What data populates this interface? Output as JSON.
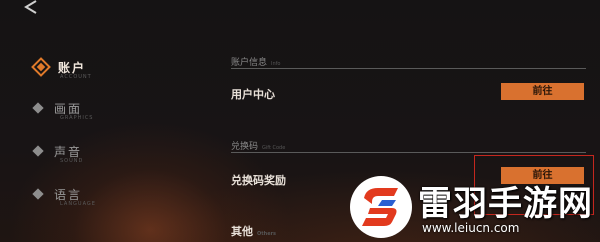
{
  "sidebar": {
    "items": [
      {
        "label": "账户",
        "sub": "ACCOUNT",
        "active": true
      },
      {
        "label": "画面",
        "sub": "GRAPHICS",
        "active": false
      },
      {
        "label": "声音",
        "sub": "SOUND",
        "active": false
      },
      {
        "label": "语言",
        "sub": "LANGUAGE",
        "active": false
      }
    ]
  },
  "main": {
    "account_section": {
      "title": "账户信息",
      "title_en": "Info"
    },
    "user_center": {
      "label": "用户中心",
      "button": "前往"
    },
    "code_section": {
      "title": "兑换码",
      "title_en": "Gift Code"
    },
    "code_reward": {
      "label": "兑换码奖励",
      "button": "前往"
    },
    "other_section": {
      "title": "其他",
      "title_en": "Others"
    }
  },
  "watermark": {
    "title": "雷羽手游网",
    "url": "www.leiucn.com"
  },
  "colors": {
    "accent": "#d9712f",
    "highlight_border": "#c4271e",
    "text_primary": "#e8e0d8"
  }
}
